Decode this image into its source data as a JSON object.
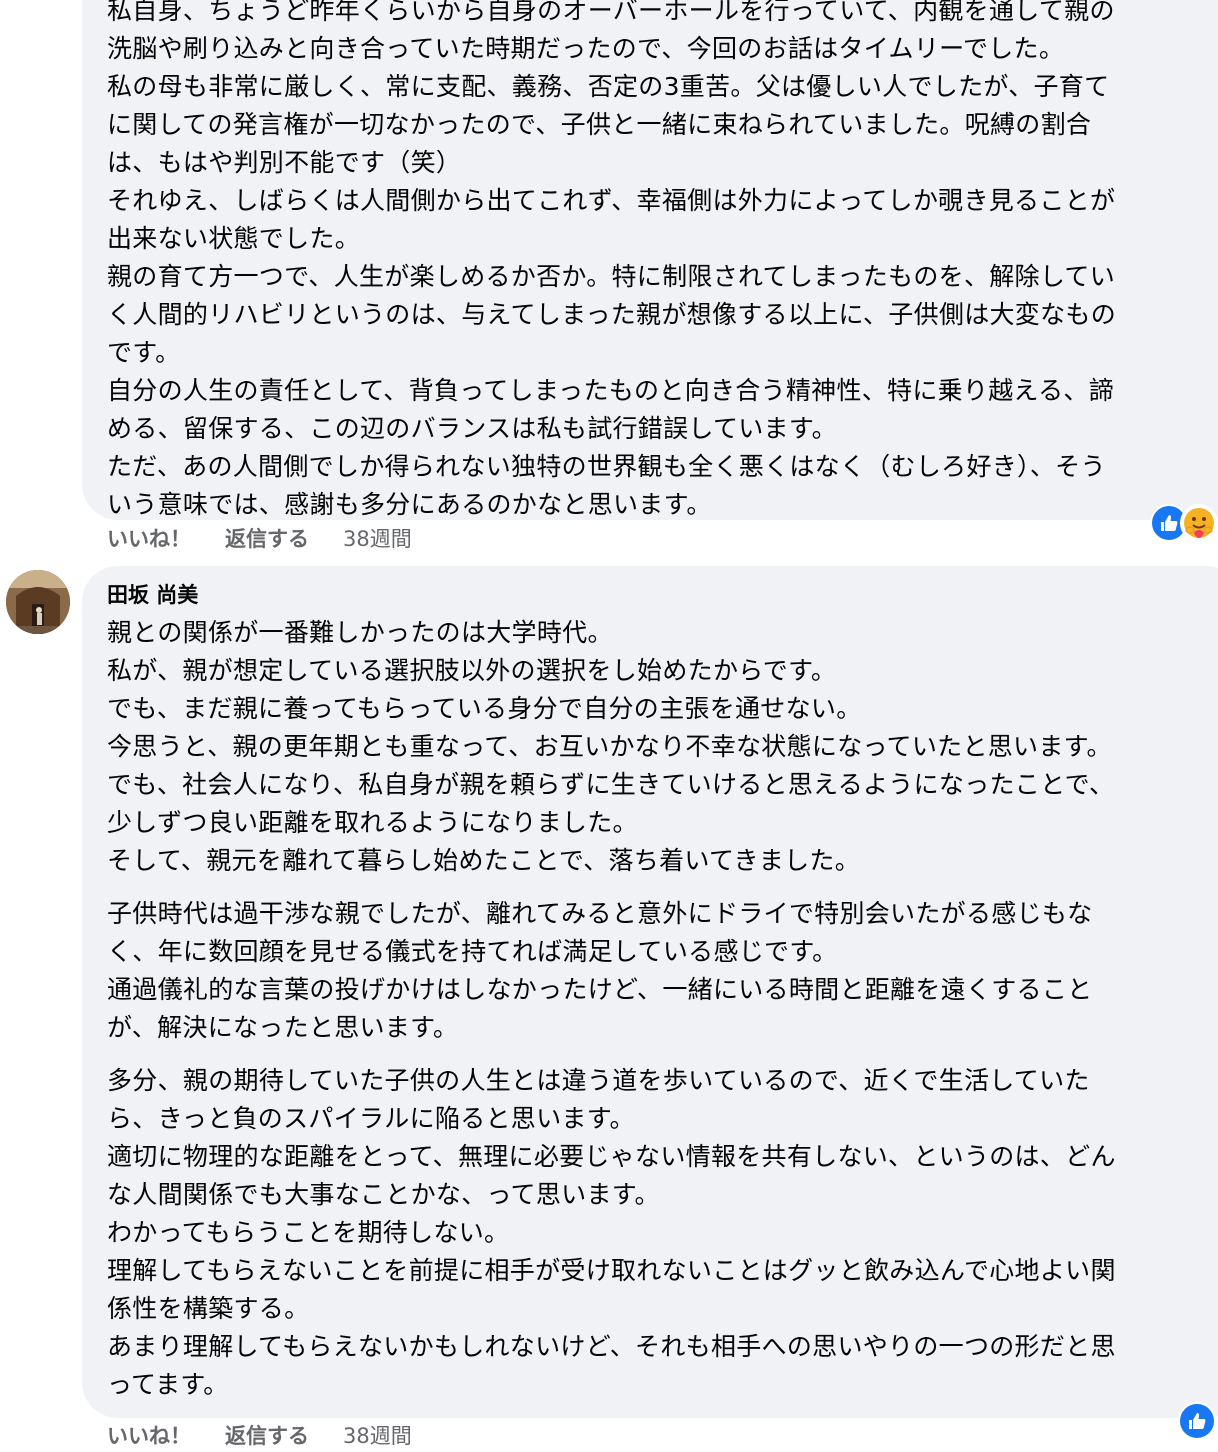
{
  "comments": [
    {
      "lines": [
        "私自身、ちょうど昨年くらいから自身のオーバーホールを行っていて、内観を通して親の",
        "洗脳や刷り込みと向き合っていた時期だったので、今回のお話はタイムリーでした。",
        "私の母も非常に厳しく、常に支配、義務、否定の3重苦。父は優しい人でしたが、子育て",
        "に関しての発言権が一切なかったので、子供と一緒に束ねられていました。呪縛の割合",
        "は、もはや判別不能です（笑）",
        "それゆえ、しばらくは人間側から出てこれず、幸福側は外力によってしか覗き見ることが",
        "出来ない状態でした。",
        "親の育て方一つで、人生が楽しめるか否か。特に制限されてしまったものを、解除してい",
        "く人間的リハビリというのは、与えてしまった親が想像する以上に、子供側は大変なもの",
        "です。",
        "自分の人生の責任として、背負ってしまったものと向き合う精神性、特に乗り越える、諦",
        "める、留保する、この辺のバランスは私も試行錯誤しています。",
        "ただ、あの人間側でしか得られない独特の世界観も全く悪くはなく（むしろ好き）、そう",
        "いう意味では、感謝も多分にあるのかなと思います。"
      ],
      "like_label": "いいね！",
      "reply_label": "返信する",
      "time": "38週間",
      "reactions": [
        "like-icon",
        "care-icon"
      ]
    },
    {
      "author": "田坂 尚美",
      "paragraphs": [
        [
          "親との関係が一番難しかったのは大学時代。",
          "私が、親が想定している選択肢以外の選択をし始めたからです。",
          "でも、まだ親に養ってもらっている身分で自分の主張を通せない。",
          "今思うと、親の更年期とも重なって、お互いかなり不幸な状態になっていたと思います。",
          "でも、社会人になり、私自身が親を頼らずに生きていけると思えるようになったことで、",
          "少しずつ良い距離を取れるようになりました。",
          "そして、親元を離れて暮らし始めたことで、落ち着いてきました。"
        ],
        [
          "子供時代は過干渉な親でしたが、離れてみると意外にドライで特別会いたがる感じもな",
          "く、年に数回顔を見せる儀式を持てれば満足している感じです。",
          "通過儀礼的な言葉の投げかけはしなかったけど、一緒にいる時間と距離を遠くすること",
          "が、解決になったと思います。"
        ],
        [
          "多分、親の期待していた子供の人生とは違う道を歩いているので、近くで生活していた",
          "ら、きっと負のスパイラルに陥ると思います。",
          "適切に物理的な距離をとって、無理に必要じゃない情報を共有しない、というのは、どん",
          "な人間関係でも大事なことかな、って思います。",
          "わかってもらうことを期待しない。",
          "理解してもらえないことを前提に相手が受け取れないことはグッと飲み込んで心地よい関",
          "係性を構築する。",
          "あまり理解してもらえないかもしれないけど、それも相手への思いやりの一つの形だと思",
          "ってます。"
        ]
      ],
      "like_label": "いいね！",
      "reply_label": "返信する",
      "time": "38週間",
      "reactions": [
        "like-icon"
      ]
    }
  ],
  "colors": {
    "bubble": "#f0f2f5",
    "text": "#050505",
    "meta": "#65676b",
    "like_blue": "#1877f2"
  }
}
